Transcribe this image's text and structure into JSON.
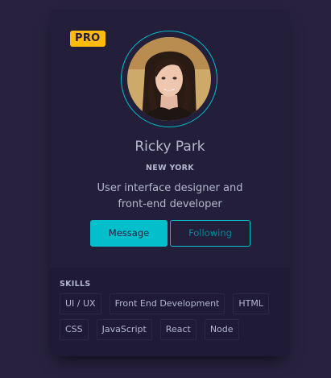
{
  "badge": "PRO",
  "profile": {
    "name": "Ricky Park",
    "city": "NEW YORK",
    "bio_line1": "User interface designer and",
    "bio_line2": "front-end developer",
    "avatar_icon": "user-avatar-photo"
  },
  "actions": {
    "message_label": "Message",
    "following_label": "Following"
  },
  "skills": {
    "title": "SKILLS",
    "items": [
      "UI / UX",
      "Front End Development",
      "HTML",
      "CSS",
      "JavaScript",
      "React",
      "Node"
    ]
  },
  "colors": {
    "page_bg": "#28223f",
    "card_bg": "#231e39",
    "skills_bg": "#1f1a36",
    "accent": "#03bfcb",
    "badge": "#febb0b",
    "text": "#b3b8cd"
  }
}
